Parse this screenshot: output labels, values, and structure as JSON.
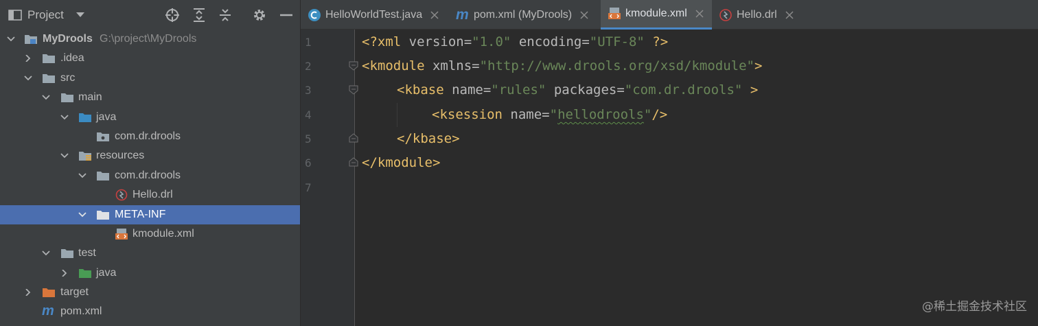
{
  "project_panel": {
    "title": "Project",
    "tree": [
      {
        "label": "MyDrools",
        "path": "G:\\project\\MyDrools"
      },
      {
        "label": ".idea"
      },
      {
        "label": "src"
      },
      {
        "label": "main"
      },
      {
        "label": "java"
      },
      {
        "label": "com.dr.drools"
      },
      {
        "label": "resources"
      },
      {
        "label": "com.dr.drools"
      },
      {
        "label": "Hello.drl"
      },
      {
        "label": "META-INF"
      },
      {
        "label": "kmodule.xml"
      },
      {
        "label": "test"
      },
      {
        "label": "java"
      },
      {
        "label": "target"
      },
      {
        "label": "pom.xml"
      }
    ]
  },
  "tabs": [
    {
      "label": "HelloWorldTest.java"
    },
    {
      "label": "pom.xml (MyDrools)"
    },
    {
      "label": "kmodule.xml"
    },
    {
      "label": "Hello.drl"
    }
  ],
  "editor": {
    "line_numbers": [
      "1",
      "2",
      "3",
      "4",
      "5",
      "6",
      "7"
    ],
    "lines": {
      "l1": {
        "a": "<?xml ",
        "b": "version",
        "c": "=",
        "d": "\"1.0\"",
        "e": " encoding",
        "f": "=",
        "g": "\"UTF-8\"",
        "h": " ?>"
      },
      "l2": {
        "a": "<kmodule ",
        "b": "xmlns",
        "c": "=",
        "d": "\"http://www.drools.org/xsd/kmodule\"",
        "e": ">"
      },
      "l3": {
        "a": "<kbase ",
        "b": "name",
        "c": "=",
        "d": "\"rules\"",
        "e": " packages",
        "f": "=",
        "g": "\"com.dr.drools\"",
        "h": " >"
      },
      "l4": {
        "a": "<ksession ",
        "b": "name",
        "c": "=",
        "d": "\"",
        "e": "hellodrools",
        "f": "\"",
        "g": "/>"
      },
      "l5": {
        "a": "</kbase>"
      },
      "l6": {
        "a": "</kmodule>"
      }
    }
  },
  "watermark": "@稀土掘金技术社区",
  "colors": {
    "panel_bg": "#3c3f41",
    "editor_bg": "#2b2b2b",
    "selection": "#4b6eaf",
    "tag": "#e8bf6a",
    "attr": "#bababa",
    "value": "#6a8759"
  }
}
